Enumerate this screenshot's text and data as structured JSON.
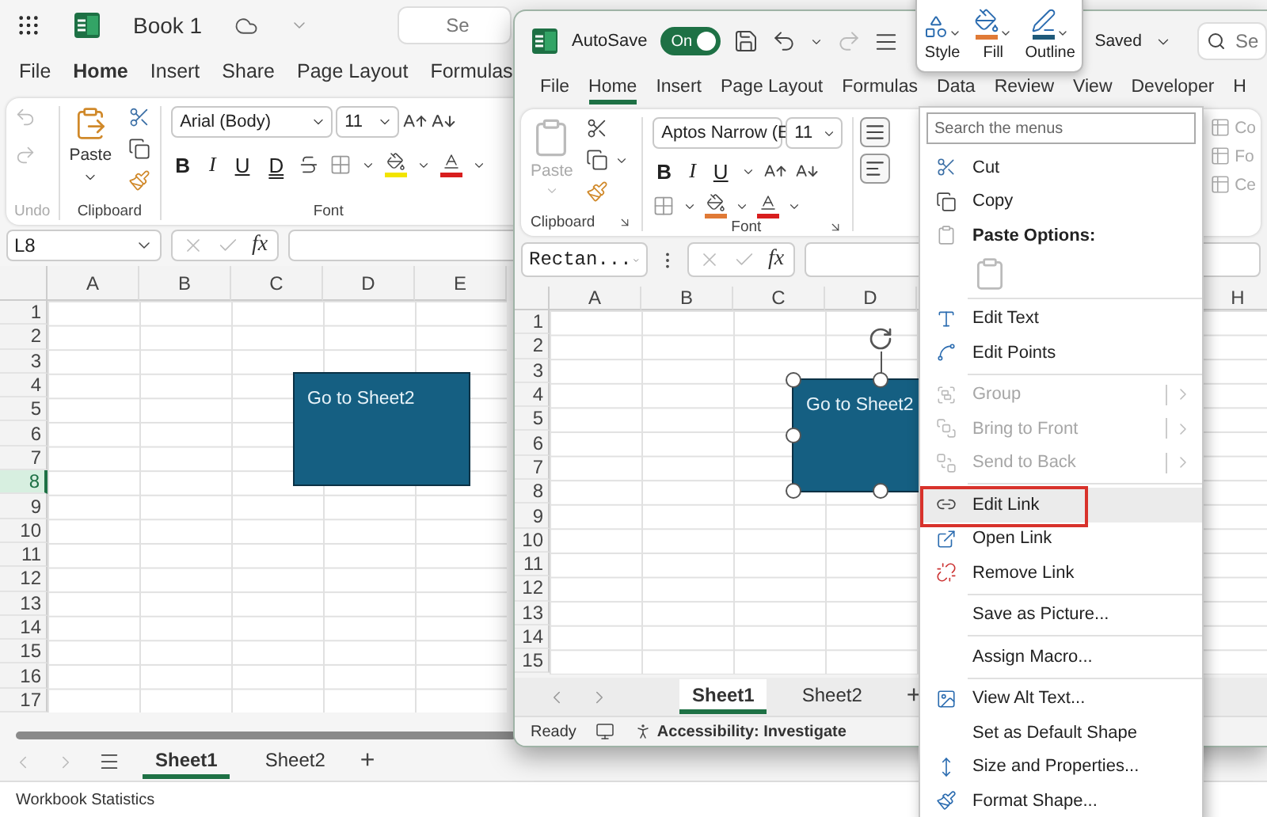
{
  "background_workbook": {
    "title": "Book 1",
    "search": "Se",
    "tabs": [
      {
        "label": "File",
        "selected": false
      },
      {
        "label": "Home",
        "selected": true
      },
      {
        "label": "Insert",
        "selected": false
      },
      {
        "label": "Share",
        "selected": false
      },
      {
        "label": "Page Layout",
        "selected": false
      },
      {
        "label": "Formulas",
        "selected": false
      }
    ],
    "ribbon": {
      "undo_group": "Undo",
      "paste": "Paste",
      "clipboard_group": "Clipboard",
      "font_name": "Arial (Body)",
      "font_size": "11",
      "font_group": "Font",
      "format_buttons": [
        {
          "label": "B",
          "kind": "bold"
        },
        {
          "label": "I",
          "kind": "italic"
        },
        {
          "label": "U",
          "kind": "underline"
        },
        {
          "label": "D",
          "kind": "double_underline"
        }
      ]
    },
    "name_box": "L8",
    "function_label": "fx",
    "columns": [
      "A",
      "B",
      "C",
      "D",
      "E"
    ],
    "rows": [
      {
        "label": "1",
        "selected": false
      },
      {
        "label": "2",
        "selected": false
      },
      {
        "label": "3",
        "selected": false
      },
      {
        "label": "4",
        "selected": false
      },
      {
        "label": "5",
        "selected": false
      },
      {
        "label": "6",
        "selected": false
      },
      {
        "label": "7",
        "selected": false
      },
      {
        "label": "8",
        "selected": true
      },
      {
        "label": "9",
        "selected": false
      },
      {
        "label": "10",
        "selected": false
      },
      {
        "label": "11",
        "selected": false
      },
      {
        "label": "12",
        "selected": false
      },
      {
        "label": "13",
        "selected": false
      },
      {
        "label": "14",
        "selected": false
      },
      {
        "label": "15",
        "selected": false
      },
      {
        "label": "16",
        "selected": false
      },
      {
        "label": "17",
        "selected": false
      }
    ],
    "shape": {
      "text": "Go to Sheet2",
      "selected": false
    },
    "sheet_tabs": [
      {
        "label": "Sheet1",
        "selected": true
      },
      {
        "label": "Sheet2",
        "selected": false
      }
    ],
    "add_sheet": "+",
    "status": "Workbook Statistics"
  },
  "front_window": {
    "autosave": {
      "label": "AutoSave",
      "on": true,
      "state_label": "On"
    },
    "saved": "Saved",
    "search": "Se",
    "tabs": [
      {
        "label": "File",
        "selected": false
      },
      {
        "label": "Home",
        "selected": true
      },
      {
        "label": "Insert",
        "selected": false
      },
      {
        "label": "Page Layout",
        "selected": false
      },
      {
        "label": "Formulas",
        "selected": false
      },
      {
        "label": "Data",
        "selected": false
      },
      {
        "label": "Review",
        "selected": false
      },
      {
        "label": "View",
        "selected": false
      },
      {
        "label": "Developer",
        "selected": false
      },
      {
        "label": "H",
        "selected": false
      }
    ],
    "ribbon": {
      "paste": "Paste",
      "paste_disabled": true,
      "clipboard_group": "Clipboard",
      "font_name": "Aptos Narrow (E",
      "font_size": "11",
      "font_group": "Font",
      "format_buttons": [
        {
          "label": "B",
          "kind": "bold"
        },
        {
          "label": "I",
          "kind": "italic"
        },
        {
          "label": "U",
          "kind": "underline"
        }
      ],
      "styles_group": [
        "Co",
        "Fo",
        "Ce"
      ]
    },
    "name_box": "Rectan...",
    "function_label": "fx",
    "columns_left": [
      "A",
      "B",
      "C",
      "D"
    ],
    "columns_right": [
      "H"
    ],
    "rows": [
      {
        "label": "1",
        "selected": false
      },
      {
        "label": "2",
        "selected": false
      },
      {
        "label": "3",
        "selected": false
      },
      {
        "label": "4",
        "selected": false
      },
      {
        "label": "5",
        "selected": false
      },
      {
        "label": "6",
        "selected": false
      },
      {
        "label": "7",
        "selected": false
      },
      {
        "label": "8",
        "selected": false
      },
      {
        "label": "9",
        "selected": false
      },
      {
        "label": "10",
        "selected": false
      },
      {
        "label": "11",
        "selected": false
      },
      {
        "label": "12",
        "selected": false
      },
      {
        "label": "13",
        "selected": false
      },
      {
        "label": "14",
        "selected": false
      },
      {
        "label": "15",
        "selected": false
      }
    ],
    "shape": {
      "text": "Go to Sheet2",
      "selected": true
    },
    "sheet_tabs": [
      {
        "label": "Sheet1",
        "selected": true
      },
      {
        "label": "Sheet2",
        "selected": false
      }
    ],
    "add_sheet": "+",
    "status": "Ready",
    "accessibility": "Accessibility: Investigate"
  },
  "mini_toolbar": [
    {
      "label": "Style"
    },
    {
      "label": "Fill",
      "color": "#e07a36"
    },
    {
      "label": "Outline",
      "color": "#1f5a7a"
    }
  ],
  "context_menu": {
    "search_placeholder": "Search the menus",
    "items": [
      {
        "kind": "item",
        "label": "Cut",
        "disabled": false,
        "submenu": false,
        "selected": false
      },
      {
        "kind": "item",
        "label": "Copy",
        "disabled": false,
        "submenu": false,
        "selected": false
      },
      {
        "kind": "header",
        "label": "Paste Options:"
      },
      {
        "kind": "paste_options"
      },
      {
        "kind": "separator"
      },
      {
        "kind": "item",
        "label": "Edit Text",
        "disabled": false,
        "submenu": false,
        "selected": false
      },
      {
        "kind": "item",
        "label": "Edit Points",
        "disabled": false,
        "submenu": false,
        "selected": false
      },
      {
        "kind": "separator"
      },
      {
        "kind": "item",
        "label": "Group",
        "disabled": true,
        "submenu": true,
        "selected": false
      },
      {
        "kind": "item",
        "label": "Bring to Front",
        "disabled": true,
        "submenu": true,
        "selected": false
      },
      {
        "kind": "item",
        "label": "Send to Back",
        "disabled": true,
        "submenu": true,
        "selected": false
      },
      {
        "kind": "separator"
      },
      {
        "kind": "item",
        "label": "Edit Link",
        "disabled": false,
        "submenu": false,
        "selected": true
      },
      {
        "kind": "item",
        "label": "Open Link",
        "disabled": false,
        "submenu": false,
        "selected": false
      },
      {
        "kind": "item",
        "label": "Remove Link",
        "disabled": false,
        "submenu": false,
        "selected": false
      },
      {
        "kind": "separator"
      },
      {
        "kind": "item",
        "label": "Save as Picture...",
        "disabled": false,
        "submenu": false,
        "selected": false
      },
      {
        "kind": "separator"
      },
      {
        "kind": "item",
        "label": "Assign Macro...",
        "disabled": false,
        "submenu": false,
        "selected": false
      },
      {
        "kind": "separator"
      },
      {
        "kind": "item",
        "label": "View Alt Text...",
        "disabled": false,
        "submenu": false,
        "selected": false
      },
      {
        "kind": "item",
        "label": "Set as Default Shape",
        "disabled": false,
        "submenu": false,
        "selected": false
      },
      {
        "kind": "item",
        "label": "Size and Properties...",
        "disabled": false,
        "submenu": false,
        "selected": false
      },
      {
        "kind": "item",
        "label": "Format Shape...",
        "disabled": false,
        "submenu": false,
        "selected": false
      }
    ]
  }
}
